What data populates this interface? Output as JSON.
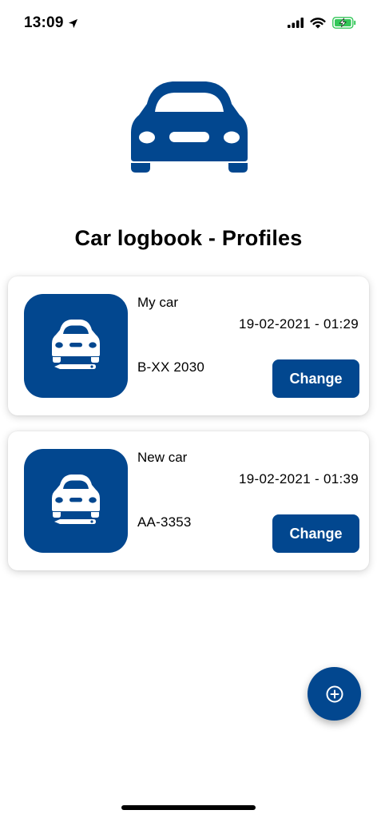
{
  "status_bar": {
    "time": "13:09",
    "icons": [
      "location-arrow-icon",
      "cellular-signal-icon",
      "wifi-icon",
      "battery-charging-icon"
    ]
  },
  "colors": {
    "brand": "#02478f",
    "battery": "#34c759"
  },
  "header": {
    "icon": "car-front-icon",
    "title": "Car logbook - Profiles"
  },
  "profiles": [
    {
      "name": "My car",
      "date": "19-02-2021 - 01:29",
      "plate": "B-XX 2030",
      "button_label": "Change",
      "icon": "car-with-pen-icon"
    },
    {
      "name": "New car",
      "date": "19-02-2021 - 01:39",
      "plate": "AA-3353",
      "button_label": "Change",
      "icon": "car-with-pen-icon"
    }
  ],
  "fab": {
    "icon": "plus-circle-icon"
  }
}
